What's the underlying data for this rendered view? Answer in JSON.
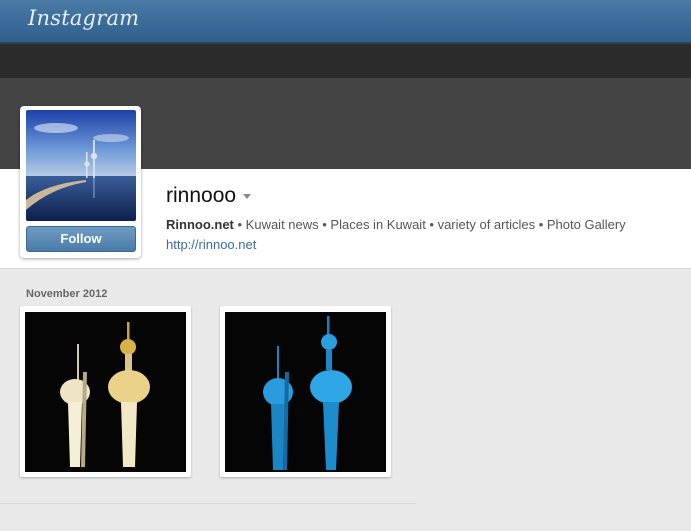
{
  "header": {
    "logo_text": "Instagram"
  },
  "profile": {
    "username": "rinnooo",
    "follow_label": "Follow",
    "bio_name": "Rinnoo.net",
    "bio_text": " • Kuwait news • Places in Kuwait • variety of articles • Photo Gallery",
    "website": "http://rinnoo.net"
  },
  "feed": {
    "month_label": "November 2012",
    "photos": [
      {
        "subject": "Kuwait Towers at night, golden lights"
      },
      {
        "subject": "Kuwait Towers at night, blue lights"
      }
    ]
  },
  "colors": {
    "topbar": "#3b6b98",
    "follow_button": "#5b8bb6",
    "link": "#3b6da0"
  }
}
